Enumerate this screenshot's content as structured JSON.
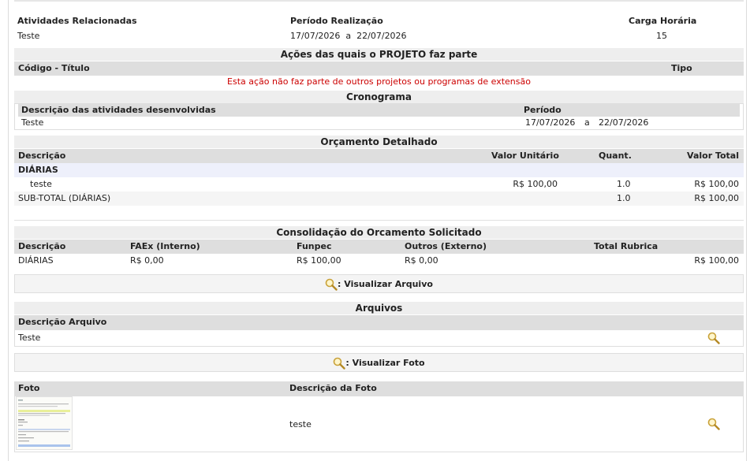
{
  "summary": {
    "activities_header": "Atividades Relacionadas",
    "activities_value": "Teste",
    "period_header": "Período Realização",
    "period_start": "17/07/2026",
    "period_sep": "a",
    "period_end": "22/07/2026",
    "hours_header": "Carga Horária",
    "hours_value": "15"
  },
  "actions": {
    "title": "Ações das quais o PROJETO faz parte",
    "col_code": "Código - Título",
    "col_type": "Tipo",
    "empty_message": "Esta ação não faz parte de outros projetos ou programas de extensão",
    "empty_color": "#cc0000"
  },
  "schedule": {
    "title": "Cronograma",
    "col_desc": "Descrição das atividades desenvolvidas",
    "col_period": "Período",
    "rows": [
      {
        "desc": "Teste",
        "start": "17/07/2026",
        "sep": "a",
        "end": "22/07/2026"
      }
    ]
  },
  "budget": {
    "title": "Orçamento Detalhado",
    "col_desc": "Descrição",
    "col_unit": "Valor Unitário",
    "col_qty": "Quant.",
    "col_total": "Valor Total",
    "group": "DIÁRIAS",
    "item": {
      "desc": "teste",
      "unit": "R$ 100,00",
      "qty": "1.0",
      "total": "R$ 100,00"
    },
    "subtotal": {
      "desc": "SUB-TOTAL (DIÁRIAS)",
      "qty": "1.0",
      "total": "R$ 100,00"
    }
  },
  "consolidation": {
    "title": "Consolidação do Orcamento Solicitado",
    "col_desc": "Descrição",
    "col_faex": "FAEx (Interno)",
    "col_funpec": "Funpec",
    "col_outros": "Outros (Externo)",
    "col_total": "Total Rubrica",
    "row": {
      "desc": "DIÁRIAS",
      "faex": "R$ 0,00",
      "funpec": "R$ 100,00",
      "outros": "R$ 0,00",
      "total": "R$ 100,00"
    }
  },
  "files": {
    "legend_label": ": Visualizar Arquivo",
    "title": "Arquivos",
    "col_desc": "Descrição Arquivo",
    "rows": [
      {
        "desc": "Teste"
      }
    ]
  },
  "photos": {
    "legend_label": ": Visualizar Foto",
    "col_photo": "Foto",
    "col_desc": "Descrição da Foto",
    "rows": [
      {
        "desc": "teste"
      }
    ]
  },
  "icons": {
    "view": "magnifier-icon"
  }
}
